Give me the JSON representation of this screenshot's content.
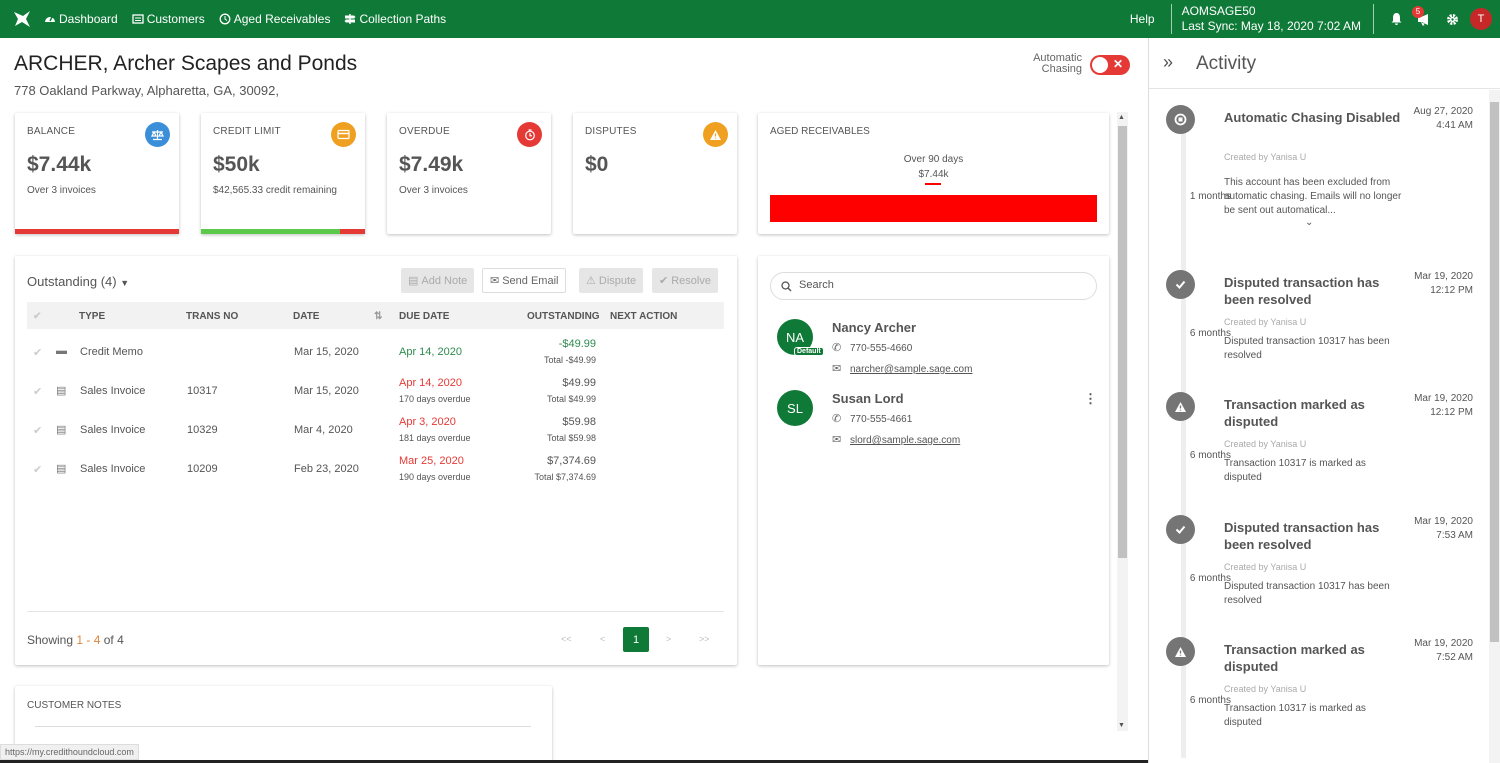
{
  "nav": {
    "items": [
      {
        "label": "Dashboard",
        "icon": "dashboard-icon"
      },
      {
        "label": "Customers",
        "icon": "list-icon"
      },
      {
        "label": "Aged Receivables",
        "icon": "clock-icon"
      },
      {
        "label": "Collection Paths",
        "icon": "signpost-icon"
      }
    ],
    "help": "Help",
    "company": "AOMSAGE50",
    "last_sync": "Last Sync: May 18, 2020 7:02 AM",
    "notif_count": "5",
    "user_initial": "T"
  },
  "customer": {
    "title": "ARCHER, Archer Scapes and Ponds",
    "address": "778 Oakland Parkway, Alpharetta, GA, 30092,",
    "auto_chasing_line1": "Automatic",
    "auto_chasing_line2": "Chasing",
    "auto_chasing_off": "✕"
  },
  "stats": {
    "balance": {
      "label": "BALANCE",
      "value": "$7.44k",
      "sub": "Over 3 invoices",
      "color": "#3b8fd9"
    },
    "credit": {
      "label": "CREDIT LIMIT",
      "value": "$50k",
      "sub": "$42,565.33 credit remaining",
      "color": "#f0a020",
      "used_fraction": 0.15
    },
    "overdue": {
      "label": "OVERDUE",
      "value": "$7.49k",
      "sub": "Over 3 invoices",
      "color": "#e53935"
    },
    "disputes": {
      "label": "DISPUTES",
      "value": "$0",
      "sub": "",
      "color": "#f0a020"
    }
  },
  "aged": {
    "label": "AGED RECEIVABLES",
    "bucket": "Over 90 days",
    "amount": "$7.44k"
  },
  "outstanding": {
    "title": "Outstanding (4)",
    "buttons": {
      "add_note": "Add Note",
      "send_email": "Send Email",
      "dispute": "Dispute",
      "resolve": "Resolve"
    },
    "columns": {
      "type": "TYPE",
      "trans_no": "TRANS NO",
      "date": "DATE",
      "due_date": "DUE DATE",
      "outstanding": "OUTSTANDING",
      "next_action": "NEXT ACTION"
    },
    "rows": [
      {
        "type": "Credit Memo",
        "trans_no": "",
        "date": "Mar 15, 2020",
        "due": "Apr 14, 2020",
        "overdue": "",
        "amount": "-$49.99",
        "total": "Total -$49.99"
      },
      {
        "type": "Sales Invoice",
        "trans_no": "10317",
        "date": "Mar 15, 2020",
        "due": "Apr 14, 2020",
        "overdue": "170 days overdue",
        "amount": "$49.99",
        "total": "Total $49.99"
      },
      {
        "type": "Sales Invoice",
        "trans_no": "10329",
        "date": "Mar 4, 2020",
        "due": "Apr 3, 2020",
        "overdue": "181 days overdue",
        "amount": "$59.98",
        "total": "Total $59.98"
      },
      {
        "type": "Sales Invoice",
        "trans_no": "10209",
        "date": "Feb 23, 2020",
        "due": "Mar 25, 2020",
        "overdue": "190 days overdue",
        "amount": "$7,374.69",
        "total": "Total $7,374.69"
      }
    ],
    "showing_prefix": "Showing",
    "showing_range": "1 - 4",
    "showing_of": "of",
    "showing_total": "4",
    "pager": {
      "first": "<<",
      "prev": "<",
      "current": "1",
      "next": ">",
      "last": ">>"
    }
  },
  "contacts": {
    "search_placeholder": "Search",
    "list": [
      {
        "initials": "NA",
        "name": "Nancy Archer",
        "phone": "770-555-4660",
        "email": "narcher@sample.sage.com",
        "badge": "Default"
      },
      {
        "initials": "SL",
        "name": "Susan Lord",
        "phone": "770-555-4661",
        "email": "slord@sample.sage.com",
        "badge": ""
      }
    ]
  },
  "notes": {
    "label": "CUSTOMER NOTES"
  },
  "status_url": "https://my.credithoundcloud.com",
  "activity": {
    "title": "Activity",
    "events": [
      {
        "title": "Automatic Chasing Disabled",
        "date": "Aug 27, 2020",
        "time": "4:41 AM",
        "by": "Created by Yanisa U",
        "ago": "1 months",
        "desc": "This account has been excluded from automatic chasing. Emails will no longer be sent out automatical...",
        "icon": "stop-icon"
      },
      {
        "title": "Disputed transaction has been resolved",
        "date": "Mar 19, 2020",
        "time": "12:12 PM",
        "by": "Created by Yanisa U",
        "ago": "6 months",
        "desc": "Disputed transaction 10317 has been resolved",
        "icon": "check-icon"
      },
      {
        "title": "Transaction marked as disputed",
        "date": "Mar 19, 2020",
        "time": "12:12 PM",
        "by": "Created by Yanisa U",
        "ago": "6 months",
        "desc": "Transaction 10317 is marked as disputed",
        "icon": "warning-icon"
      },
      {
        "title": "Disputed transaction has been resolved",
        "date": "Mar 19, 2020",
        "time": "7:53 AM",
        "by": "Created by Yanisa U",
        "ago": "6 months",
        "desc": "Disputed transaction 10317 has been resolved",
        "icon": "check-icon"
      },
      {
        "title": "Transaction marked as disputed",
        "date": "Mar 19, 2020",
        "time": "7:52 AM",
        "by": "Created by Yanisa U",
        "ago": "6 months",
        "desc": "Transaction 10317 is marked as disputed",
        "icon": "warning-icon"
      }
    ]
  }
}
